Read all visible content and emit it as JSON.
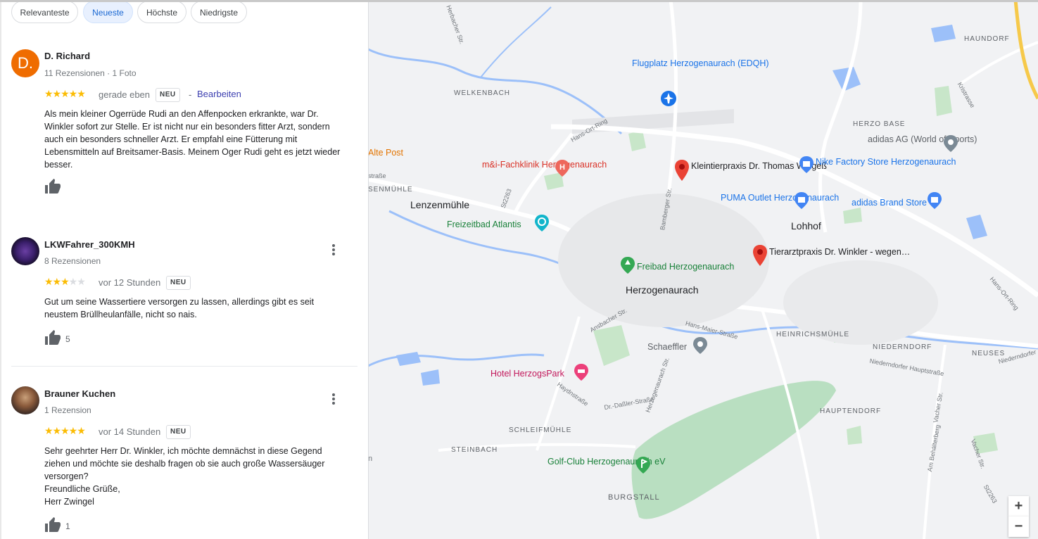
{
  "filters": {
    "chips": [
      "Relevanteste",
      "Neueste",
      "Höchste",
      "Niedrigste"
    ],
    "active": "Neueste"
  },
  "reviews": [
    {
      "initial": "D.",
      "name": "D. Richard",
      "meta": "11 Rezensionen · 1 Foto",
      "rating": 5,
      "stars_text": "★★★★★",
      "time": "gerade eben",
      "badge": "NEU",
      "separator": "-",
      "edit_label": "Bearbeiten",
      "text": "Als mein kleiner Ogerrüde Rudi an den Affenpocken erkrankte, war Dr.\nWinkler sofort zur Stelle. Er ist nicht nur ein besonders fitter Arzt, sondern\nauch ein besonders schneller Arzt. Er empfahl eine Fütterung mit\nLebensmitteln auf  Breitsamer-Basis. Meinem Oger Rudi  geht es jetzt wieder\nbesser.",
      "likes": ""
    },
    {
      "name": "LKWFahrer_300KMH",
      "meta": "8 Rezensionen",
      "rating": 3,
      "stars_on": "★★★",
      "stars_off": "★★",
      "time": "vor 12 Stunden",
      "badge": "NEU",
      "text": "Gut  um seine Wassertiere versorgen zu lassen, allerdings gibt es seit\nneustem Brüllheulanfälle, nicht so nais.",
      "likes": "5"
    },
    {
      "name": "Brauner Kuchen",
      "meta": "1 Rezension",
      "rating": 5,
      "stars_text": "★★★★★",
      "time": "vor 14 Stunden",
      "badge": "NEU",
      "text": "Sehr geehrter Herr Dr. Winkler, ich möchte demnächst in diese Gegend\nziehen und möchte sie deshalb fragen ob sie auch große Wassersäuger\nversorgen?\nFreundliche Grüße,\nHerr Zwingel",
      "likes": "1"
    }
  ],
  "map": {
    "places": {
      "flugplatz": "Flugplatz\nHerzogenaurach\n(EDQH)",
      "fachklinik": "m&i-Fachklinik\nHerzogenaurach",
      "kleintierpraxis": "Kleintierpraxis Dr.\nThomas Wingeß",
      "nike": "Nike Factory Store\nHerzogenaurach",
      "adidas_ag": "adidas AG\n(World of Sports)",
      "puma": "PUMA Outlet\nHerzogenaurach",
      "adidas_brand": "adidas Brand Store",
      "freizeitbad": "Freizeitbad Atlantis",
      "tierarztpraxis": "Tierarztpraxis Dr.\nWinkler - wegen…",
      "freibad": "Freibad Herzogenaurach",
      "schaeffler": "Schaeffler",
      "hotel": "Hotel HerzogsPark",
      "golf": "Golf-Club\nHerzogenaurach eV",
      "alte_post": "Alte Post"
    },
    "towns": {
      "lenzenmuehle": "Lenzenmühle",
      "lohhof": "Lohhof",
      "herzogenaurach": "Herzogenaurach"
    },
    "districts": {
      "haundorf": "HAUNDORF",
      "welkenbach": "WELKENBACH",
      "herzo_base": "HERZO BASE",
      "senmuehle": "SENMÜHLE",
      "heinrichsmuehle": "HEINRICHSMÜHLE",
      "niederndorf": "NIEDERNDORF",
      "neuses": "NEUSES",
      "hauptendorf": "HAUPTENDORF",
      "schleifmuehle": "SCHLEIFMÜHLE",
      "steinbach": "STEINBACH",
      "burgstall": "BURGSTALL"
    },
    "streets": {
      "herbacher": "Herbacher Str.",
      "hans_ort_ring": "Hans-Ort-Ring",
      "hans_ort_ring_2": "Hans-Ort-Ring",
      "kristrasse": "Kristrasse",
      "st2263": "St2263",
      "st2263_2": "St2263",
      "bamberger": "Bamberger Str.",
      "ansbacher": "Ansbacher Str.",
      "hans_maier": "Hans-Maier-Straße",
      "niederndorfer_haupt": "Niederndorfer Hauptstraße",
      "niederndorfer": "Niederndorfer",
      "haydnstrasse": "Haydnstraße",
      "dr_dassler": "Dr.-Daßler-Straße",
      "herzogenaurach_str": "Herzogenaurach Str.",
      "am_behaelterberg": "Am Behälterberg",
      "vacher": "Vacher Str.",
      "vacher_2": "Vacher Str.",
      "strasse": "straße",
      "n": "n"
    },
    "zoom_in": "+",
    "zoom_out": "−"
  }
}
